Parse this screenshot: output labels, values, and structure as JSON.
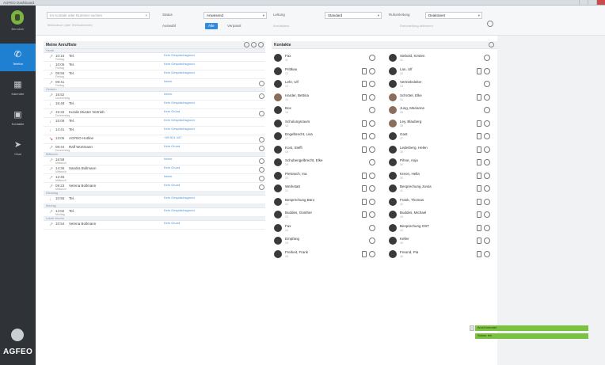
{
  "window": {
    "title": "AGFEO Dashboard"
  },
  "rail": {
    "user_label": "Benutzer",
    "items": [
      {
        "label": "Telefon",
        "icon": "phone-icon"
      },
      {
        "label": "Kalender",
        "icon": "calendar-icon"
      },
      {
        "label": "Kontakte",
        "icon": "contacts-icon"
      },
      {
        "label": "Chat",
        "icon": "chat-icon"
      }
    ],
    "brand": "AGFEO"
  },
  "toolbar": {
    "search_placeholder": "Im Kontakt oder Nummer suchen",
    "search_sub": "Telefonbuch (alle Telefonbücher)",
    "status_label": "Status",
    "status_value": "Anwesend",
    "status_sub": "Auswahl",
    "btn_all": "Alle",
    "btn_missed": "Verpasst",
    "line_label": "Leitung",
    "line_value": "Standard",
    "line_sub": "Anrufstatus",
    "forward_label": "Rufumleitung",
    "forward_value": "Deaktiviert",
    "forward_sub": "Rufumleitung aktivieren"
  },
  "calls": {
    "title": "Meine Anrufliste",
    "groups": [
      {
        "header": "Heute",
        "rows": [
          {
            "dir": "out",
            "time": "10:16",
            "date": "Freitag",
            "who": "Tel.",
            "reason": "Kein Gesprächsgrund",
            "phone": false
          },
          {
            "dir": "in",
            "time": "10:05",
            "date": "Freitag",
            "who": "Tel.",
            "reason": "Kein Gesprächsgrund",
            "phone": false
          },
          {
            "dir": "out",
            "time": "09:56",
            "date": "Freitag",
            "who": "Tel.",
            "reason": "Kein Gesprächsgrund",
            "phone": false
          },
          {
            "dir": "out",
            "time": "09:41",
            "date": "Freitag",
            "who": "",
            "reason": "Intern",
            "phone": true
          }
        ]
      },
      {
        "header": "Gestern",
        "rows": [
          {
            "dir": "out",
            "time": "16:52",
            "date": "Donnerstag",
            "who": "",
            "reason": "Intern",
            "phone": true
          },
          {
            "dir": "in",
            "time": "16:48",
            "date": "",
            "who": "Tel.",
            "reason": "Kein Gesprächsgrund",
            "phone": false
          },
          {
            "dir": "out",
            "time": "15:33",
            "date": "Donnerstag",
            "who": "Kunde Muster Vertrieb",
            "reason": "Kein Grund",
            "phone": true
          },
          {
            "dir": "in",
            "time": "15:08",
            "date": "",
            "who": "Tel.",
            "reason": "Kein Gesprächsgrund",
            "phone": false
          },
          {
            "dir": "in",
            "time": "14:41",
            "date": "",
            "who": "Tel.",
            "reason": "Kein Gesprächsgrund",
            "phone": false
          },
          {
            "dir": "missed",
            "time": "13:05",
            "date": "",
            "who": "AGFEO Hotline",
            "reason": "+49 521 447",
            "phone": true
          },
          {
            "dir": "out",
            "time": "09:44",
            "date": "Donnerstag",
            "who": "Ralf Wortmann",
            "reason": "Kein Grund",
            "phone": true
          }
        ]
      },
      {
        "header": "Mittwoch",
        "rows": [
          {
            "dir": "out",
            "time": "16:58",
            "date": "Mittwoch",
            "who": "",
            "reason": "Intern",
            "phone": true
          },
          {
            "dir": "out",
            "time": "14:36",
            "date": "Mittwoch",
            "who": "Sandra Bollmann",
            "reason": "Kein Grund",
            "phone": true
          },
          {
            "dir": "out",
            "time": "12:45",
            "date": "Mittwoch",
            "who": "",
            "reason": "Intern",
            "phone": true
          },
          {
            "dir": "out",
            "time": "09:23",
            "date": "Mittwoch",
            "who": "Verena Bollmann",
            "reason": "Kein Grund",
            "phone": true
          }
        ]
      },
      {
        "header": "Dienstag",
        "rows": [
          {
            "dir": "in",
            "time": "10:56",
            "date": "",
            "who": "Tel.",
            "reason": "Kein Gesprächsgrund",
            "phone": false
          }
        ]
      },
      {
        "header": "Montag",
        "rows": [
          {
            "dir": "out",
            "time": "14:02",
            "date": "Montag",
            "who": "Tel.",
            "reason": "Kein Gesprächsgrund",
            "phone": false
          }
        ]
      },
      {
        "header": "Letzte Woche",
        "rows": [
          {
            "dir": "out",
            "time": "10:54",
            "date": "",
            "who": "Verena Bollmann",
            "reason": "Kein Grund",
            "phone": false
          }
        ]
      }
    ]
  },
  "contacts": {
    "title": "Kontakte",
    "left": [
      {
        "name": "Fax",
        "sub": "11",
        "photo": false,
        "mobile": false
      },
      {
        "name": "Prittkau",
        "sub": "12",
        "photo": false,
        "mobile": true
      },
      {
        "name": "Lehr, Ulf",
        "sub": "13",
        "photo": false,
        "mobile": true
      },
      {
        "name": "Harder, Bettina",
        "sub": "14",
        "photo": true,
        "mobile": true
      },
      {
        "name": "Box",
        "sub": "15",
        "photo": false,
        "mobile": false
      },
      {
        "name": "Schulungsraum",
        "sub": "16",
        "photo": false,
        "mobile": true
      },
      {
        "name": "Engelbrecht, Lisa",
        "sub": "17",
        "photo": false,
        "mobile": true
      },
      {
        "name": "Kost, Steffi",
        "sub": "18",
        "photo": false,
        "mobile": true
      },
      {
        "name": "Schubengelbrecht, Elke",
        "sub": "19",
        "photo": false,
        "mobile": false
      },
      {
        "name": "Pietrasch, Ina",
        "sub": "20",
        "photo": false,
        "mobile": true
      },
      {
        "name": "Werkstatt",
        "sub": "21",
        "photo": false,
        "mobile": true
      },
      {
        "name": "Besprechung Büro",
        "sub": "22",
        "photo": false,
        "mobile": true
      },
      {
        "name": "Buddes, Günther",
        "sub": "23",
        "photo": false,
        "mobile": true
      },
      {
        "name": "Fax",
        "sub": "24",
        "photo": false,
        "mobile": false
      },
      {
        "name": "Empfang",
        "sub": "25",
        "photo": false,
        "mobile": false
      },
      {
        "name": "Freiheit, Frank",
        "sub": "26",
        "photo": false,
        "mobile": true
      }
    ],
    "right": [
      {
        "name": "Siebold, Kirsten",
        "sub": "31",
        "photo": false,
        "mobile": false
      },
      {
        "name": "Lan, Ulf",
        "sub": "32",
        "photo": false,
        "mobile": true
      },
      {
        "name": "Vertriebsleiter",
        "sub": "33",
        "photo": false,
        "mobile": false
      },
      {
        "name": "Schrötel, Elke",
        "sub": "34",
        "photo": true,
        "mobile": true
      },
      {
        "name": "Jung, Marianne",
        "sub": "35",
        "photo": true,
        "mobile": false
      },
      {
        "name": "Ley, Blauberg",
        "sub": "36",
        "photo": true,
        "mobile": true
      },
      {
        "name": "Gast",
        "sub": "37",
        "photo": false,
        "mobile": true
      },
      {
        "name": "Lederberg, Helen",
        "sub": "38",
        "photo": false,
        "mobile": true
      },
      {
        "name": "Pihne, Anja",
        "sub": "39",
        "photo": false,
        "mobile": true
      },
      {
        "name": "Kreon, Hella",
        "sub": "40",
        "photo": false,
        "mobile": true
      },
      {
        "name": "Besprechung Jonas",
        "sub": "41",
        "photo": false,
        "mobile": true
      },
      {
        "name": "Frank, Thomas",
        "sub": "42",
        "photo": false,
        "mobile": true
      },
      {
        "name": "Buddes, Michael",
        "sub": "43",
        "photo": false,
        "mobile": true
      },
      {
        "name": "Besprechung OST",
        "sub": "44",
        "photo": false,
        "mobile": true
      },
      {
        "name": "Keller",
        "sub": "45",
        "photo": false,
        "mobile": true
      },
      {
        "name": "Freund, Pia",
        "sub": "46",
        "photo": false,
        "mobile": true
      }
    ]
  },
  "notifications": [
    {
      "text": "Anruf beendet"
    },
    {
      "text": "Status: frei"
    }
  ],
  "colors": {
    "accent": "#1f7fd1",
    "rail": "#2f3338",
    "brand_green": "#7cb342",
    "notify": "#7cc242"
  }
}
